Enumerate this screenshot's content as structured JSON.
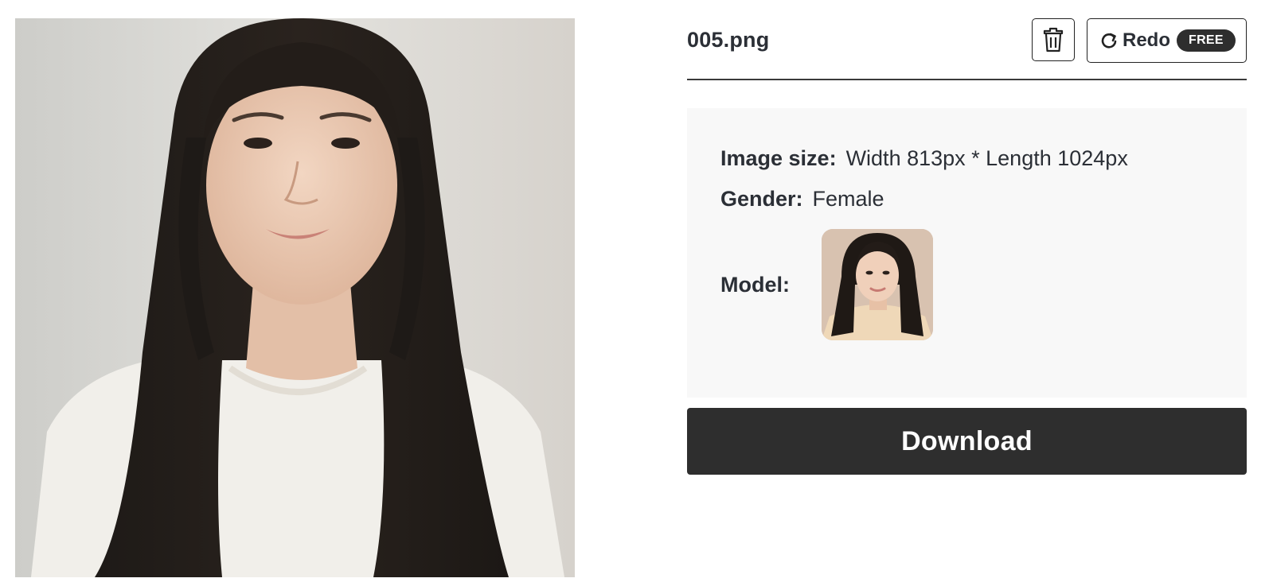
{
  "photo": {
    "alt": "Portrait of a woman with long dark hair wearing a white t-shirt"
  },
  "header": {
    "filename": "005.png",
    "delete_icon": "trash-icon",
    "redo_icon": "redo-arrow-icon",
    "redo_label": "Redo",
    "redo_badge": "FREE"
  },
  "info": {
    "size_label": "Image size:",
    "size_value": "Width 813px * Length 1024px",
    "gender_label": "Gender:",
    "gender_value": "Female",
    "model_label": "Model:"
  },
  "download_label": "Download",
  "colors": {
    "primary_dark": "#2e2e2e",
    "card_bg": "#f8f8f8",
    "text": "#2b2f36"
  }
}
